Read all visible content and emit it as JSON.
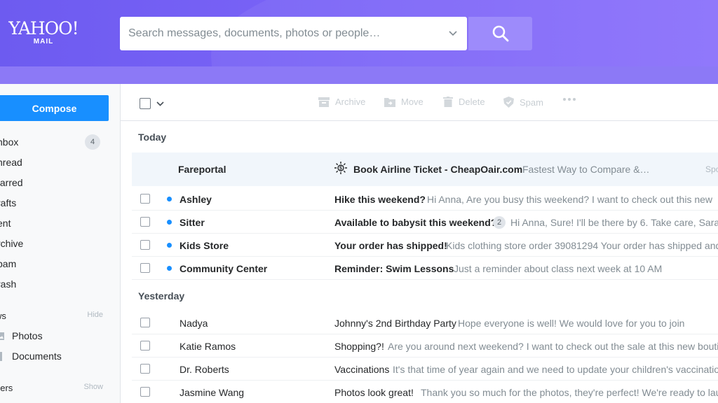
{
  "header": {
    "logo_brand": "YAHOO!",
    "logo_sub": "MAIL",
    "search_placeholder": "Search messages, documents, photos or people…"
  },
  "sidebar": {
    "compose_label": "Compose",
    "folders": [
      {
        "name": "nbox",
        "count": "4"
      },
      {
        "name": "nread"
      },
      {
        "name": "tarred"
      },
      {
        "name": "rafts"
      },
      {
        "name": "ent"
      },
      {
        "name": "rchive"
      },
      {
        "name": "pam"
      },
      {
        "name": "rash"
      }
    ],
    "views": {
      "label": "ws",
      "action": "Hide",
      "items": [
        {
          "name": "Photos"
        },
        {
          "name": "Documents"
        }
      ]
    },
    "folders_section": {
      "label": "ders",
      "action": "Show"
    }
  },
  "toolbar": {
    "archive": "Archive",
    "move": "Move",
    "delete": "Delete",
    "spam": "Spam"
  },
  "groups": {
    "today": "Today",
    "yesterday": "Yesterday"
  },
  "ad": {
    "sender": "Fareportal",
    "subject": "Book Airline Ticket - CheapOair.com",
    "preview": "Fastest Way to Compare &…",
    "sponsor": "Spo"
  },
  "messages_today": [
    {
      "sender": "Ashley",
      "subject": "Hike this weekend?",
      "preview": "Hi Anna, Are you busy this weekend? I want to check out this new"
    },
    {
      "sender": "Sitter",
      "subject": "Available to babysit this weekend?",
      "count": "2",
      "preview": "Hi Anna, Sure! I'll be there by 6. Take care, Sara"
    },
    {
      "sender": "Kids Store",
      "subject": "Your order has shipped!",
      "preview": "Kids clothing store order 39081294 Your order has shipped and"
    },
    {
      "sender": "Community Center",
      "subject": "Reminder: Swim Lessons",
      "preview": "Just a reminder about class next week at 10 AM"
    }
  ],
  "messages_yesterday": [
    {
      "sender": "Nadya",
      "subject": "Johnny's 2nd Birthday Party",
      "preview": "Hope everyone is well! We would love for you to join"
    },
    {
      "sender": "Katie Ramos",
      "subject": "Shopping?!",
      "preview": "Are you around next weekend? I want to check out the sale at this new boutique"
    },
    {
      "sender": "Dr. Roberts",
      "subject": "Vaccinations",
      "preview": "It's that time of year again and we need to update your children's vaccinations"
    },
    {
      "sender": "Jasmine Wang",
      "subject": "Photos look great!",
      "preview": "Thank you so much for the photos, they're perfect! We're ready to launch"
    }
  ],
  "colors": {
    "brand": "#7a63f7",
    "compose": "#188fff",
    "unread_dot": "#188fff"
  }
}
